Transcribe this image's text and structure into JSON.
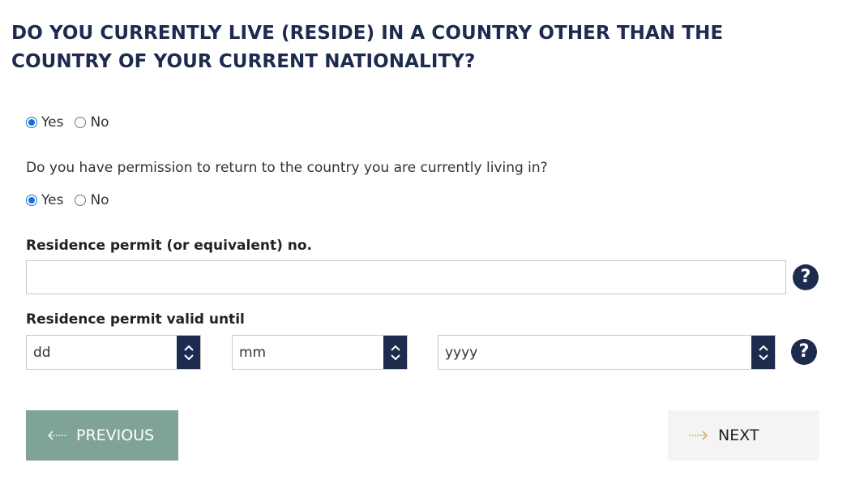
{
  "question1": {
    "title": "DO YOU CURRENTLY LIVE (RESIDE) IN A COUNTRY OTHER THAN THE COUNTRY OF YOUR CURRENT NATIONALITY?",
    "yes_label": "Yes",
    "no_label": "No",
    "selected": "Yes"
  },
  "question2": {
    "text": "Do you have permission to return to the country you are currently living in?",
    "yes_label": "Yes",
    "no_label": "No",
    "selected": "Yes"
  },
  "permit_number": {
    "label": "Residence permit (or equivalent) no.",
    "value": "",
    "help_icon": "question-circle-icon"
  },
  "permit_valid_until": {
    "label": "Residence permit valid until",
    "day": "dd",
    "month": "mm",
    "year": "yyyy",
    "help_icon": "question-circle-icon"
  },
  "navigation": {
    "previous_label": "PREVIOUS",
    "next_label": "NEXT"
  },
  "colors": {
    "title": "#1d2b4f",
    "accent_dark": "#1d2b4f",
    "previous_bg": "#7fa396",
    "next_bg": "#f4f4f4",
    "next_arrow": "#c8a04a",
    "radio_checked": "#1a6fd8"
  }
}
